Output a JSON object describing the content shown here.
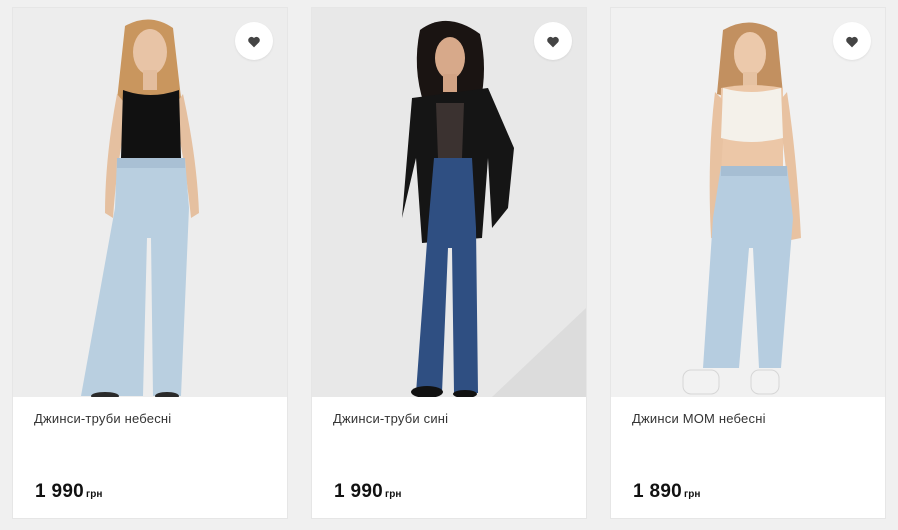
{
  "products": [
    {
      "name": "Джинси-труби небесні",
      "price": "1 990",
      "currency": "грн",
      "favorite_icon": "heart-icon",
      "photo": {
        "background": "#ededed",
        "top_color": "#111111",
        "jeans_color": "#b9cfe0",
        "shoe_color": "#2a2a2a",
        "hair_color": "#c9965e"
      }
    },
    {
      "name": "Джинси-труби сині",
      "price": "1 990",
      "currency": "грн",
      "favorite_icon": "heart-icon",
      "photo": {
        "background": "#e8e8e8",
        "top_color": "#151515",
        "jeans_color": "#2f4f82",
        "shoe_color": "#111111",
        "hair_color": "#1a1412"
      }
    },
    {
      "name": "Джинси МОМ небесні",
      "price": "1 890",
      "currency": "грн",
      "favorite_icon": "heart-icon",
      "photo": {
        "background": "#f1f1f1",
        "top_color": "#f4f1ea",
        "jeans_color": "#b6cde0",
        "shoe_color": "#f2f2f2",
        "hair_color": "#c29060"
      }
    }
  ],
  "colors": {
    "page_bg": "#f0f0f0",
    "card_bg": "#ffffff",
    "text": "#333333",
    "price": "#111111",
    "heart": "#444444"
  }
}
